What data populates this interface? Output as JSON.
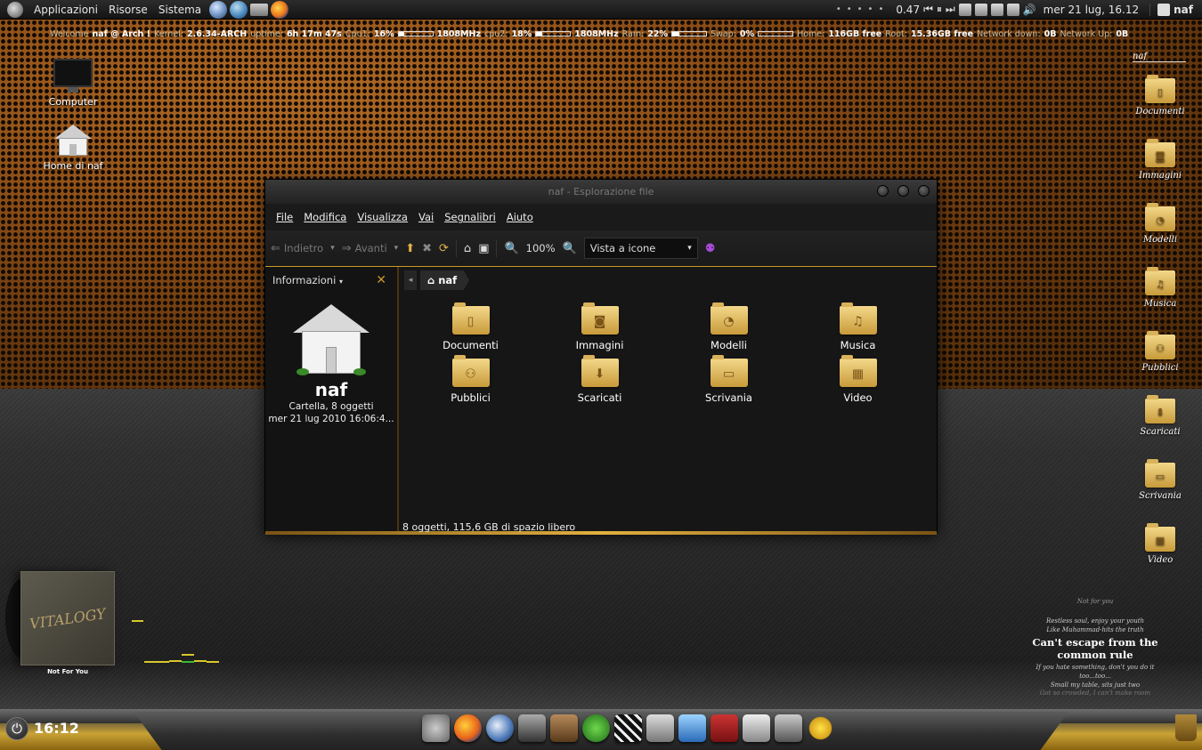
{
  "top_panel": {
    "menus": [
      "Applicazioni",
      "Risorse",
      "Sistema"
    ],
    "load_value": "0.47",
    "clock": "mer 21 lug, 16.12",
    "user": "naf"
  },
  "conky": {
    "welcome": "Welcome",
    "user_host": "naf @ Arch !",
    "kernel_label": "Kernel:",
    "kernel": "2.6.34-ARCH",
    "uptime_label": "uptime:",
    "uptime": "6h 17m 47s",
    "cpu1_label": "Cpu1:",
    "cpu1_pct": "16%",
    "cpu1_freq": "1808MHz",
    "cpu2_label": "cpu2:",
    "cpu2_pct": "18%",
    "cpu2_freq": "1808MHz",
    "ram_label": "Ram:",
    "ram_pct": "22%",
    "swap_label": "Swap:",
    "swap_pct": "0%",
    "home_label": "Home:",
    "home_free": "116GB free",
    "root_label": "Root:",
    "root_free": "15.36GB free",
    "net_down_label": "Network down:",
    "net_down": "0B",
    "net_up_label": "Network Up:",
    "net_up": "0B",
    "cpu1_fill": 0.16,
    "cpu2_fill": 0.18,
    "ram_fill": 0.22,
    "swap_fill": 0.0
  },
  "desktop": {
    "computer_label": "Computer",
    "home_label": "Home di naf",
    "right_header": "naf",
    "right_folders": [
      "Documenti",
      "Immagini",
      "Modelli",
      "Musica",
      "Pubblici",
      "Scaricati",
      "Scrivania",
      "Video"
    ]
  },
  "window": {
    "title": "naf - Esplorazione file",
    "menu": [
      "File",
      "Modifica",
      "Visualizza",
      "Vai",
      "Segnalibri",
      "Aiuto"
    ],
    "toolbar": {
      "back": "Indietro",
      "forward": "Avanti",
      "zoom": "100%",
      "view_mode": "Vista a icone"
    },
    "sidebar": {
      "header": "Informazioni",
      "name": "naf",
      "info_line1": "Cartella, 8 oggetti",
      "info_line2": "mer 21 lug 2010 16:06:4..."
    },
    "breadcrumb": "naf",
    "items": [
      "Documenti",
      "Immagini",
      "Modelli",
      "Musica",
      "Pubblici",
      "Scaricati",
      "Scrivania",
      "Video"
    ],
    "status": "8 oggetti, 115,6 GB di spazio libero"
  },
  "music": {
    "album_art_text": "VITALOGY",
    "track": "Not For You"
  },
  "lyrics": {
    "title": "Not for you",
    "lines_before": [
      "Restless soul, enjoy your youth",
      "Like Muhammad-hits the truth"
    ],
    "current": "Can't escape from the common rule",
    "lines_after": [
      "If you hate something, don't you do it",
      "too...too...",
      "Small my table, sits just two"
    ],
    "faded": "Got so crowded, I can't make room"
  },
  "dock": {
    "clock": "16:12"
  }
}
